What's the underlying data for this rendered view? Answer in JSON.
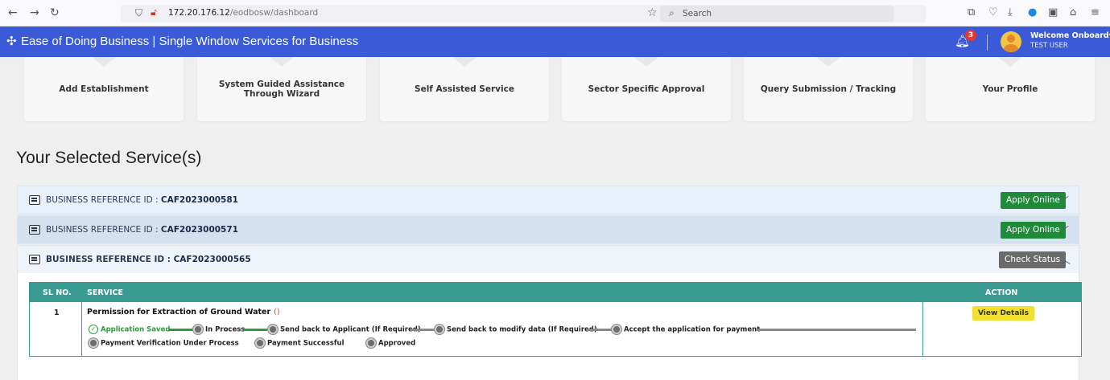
{
  "browser": {
    "url_host": "172.20.176.12",
    "url_path": "/eodbosw/dashboard",
    "search_placeholder": "Search"
  },
  "header": {
    "title": "Ease of Doing Business | Single Window Services for Business",
    "notification_count": "3",
    "welcome": "Welcome Onboard",
    "user": "TEST USER"
  },
  "nav_cards": [
    {
      "label": "Add Establishment"
    },
    {
      "label": "System Guided Assistance Through Wizard"
    },
    {
      "label": "Self Assisted Service"
    },
    {
      "label": "Sector Specific Approval"
    },
    {
      "label": "Query Submission / Tracking"
    },
    {
      "label": "Your Profile"
    }
  ],
  "page_title": "Your Selected Service(s)",
  "references": [
    {
      "prefix": "BUSINESS REFERENCE ID :",
      "id": "CAF2023000581",
      "action": "Apply Online"
    },
    {
      "prefix": "BUSINESS REFERENCE ID :",
      "id": "CAF2023000571",
      "action": "Apply Online"
    },
    {
      "prefix": "BUSINESS REFERENCE ID :",
      "id": "CAF2023000565",
      "action": "Check Status"
    }
  ],
  "table": {
    "headers": {
      "sl": "SL NO.",
      "service": "SERVICE",
      "action": "ACTION"
    },
    "rows": [
      {
        "sl": "1",
        "service": "Permission for Extraction of Ground Water",
        "service_suffix": "()",
        "action": "View Details"
      }
    ]
  },
  "steps": [
    {
      "label": "Application Saved",
      "done": true
    },
    {
      "label": "In Process",
      "done": false
    },
    {
      "label": "Send back to Applicant (If Required)",
      "done": false
    },
    {
      "label": "Send back to modify data (If Required)",
      "done": false
    },
    {
      "label": "Accept the application for payment",
      "done": false
    },
    {
      "label": "Payment Verification Under Process",
      "done": false
    },
    {
      "label": "Payment Successful",
      "done": false
    },
    {
      "label": "Approved",
      "done": false
    }
  ],
  "colors": {
    "header_blue": "#3a5ad8",
    "table_teal": "#3a9b92",
    "apply_green": "#1e8a3a",
    "check_gray": "#6b6b6b",
    "view_yellow": "#f0e130"
  }
}
